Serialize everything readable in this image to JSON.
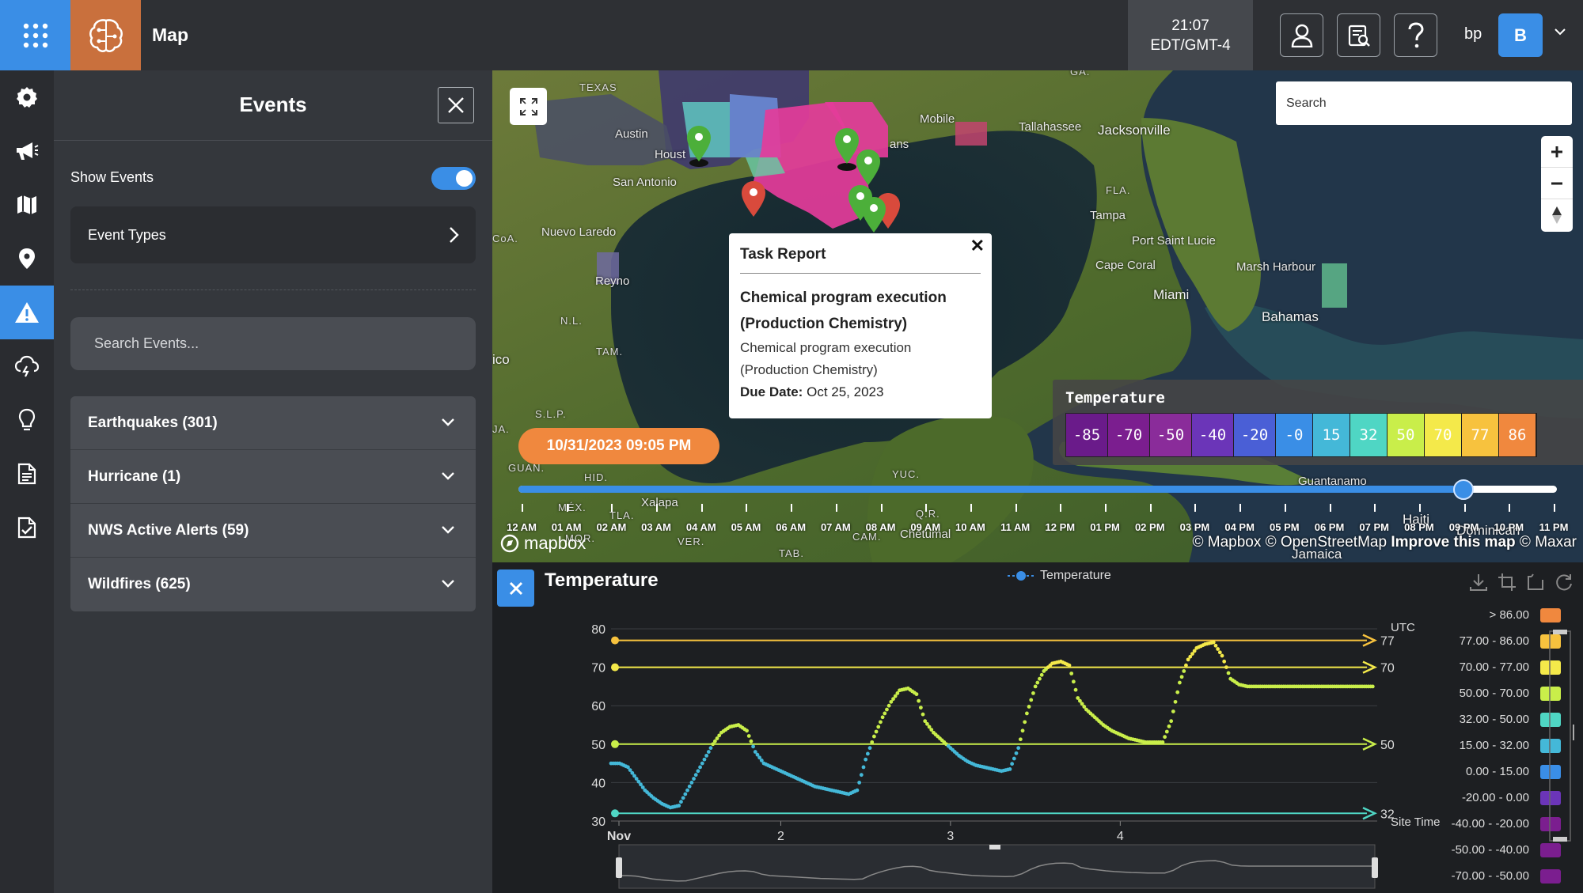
{
  "topbar": {
    "app_title": "Map",
    "clock_time": "21:07",
    "clock_zone": "EDT/GMT-4",
    "user_initials": "bp",
    "avatar_letter": "B"
  },
  "rail": {
    "items": [
      "settings",
      "announcements",
      "map",
      "locations",
      "events",
      "weather",
      "insights",
      "reports",
      "tasks"
    ],
    "active_index": 4
  },
  "events_panel": {
    "title": "Events",
    "show_events_label": "Show Events",
    "show_events_on": true,
    "event_types_label": "Event Types",
    "search_placeholder": "Search Events...",
    "categories": [
      {
        "label": "Earthquakes (301)"
      },
      {
        "label": "Hurricane (1)"
      },
      {
        "label": "NWS Active Alerts (59)"
      },
      {
        "label": "Wildfires (625)"
      }
    ]
  },
  "map": {
    "search_placeholder": "Search",
    "labels": [
      "TEXAS",
      "Austin",
      "Houst",
      "San Antonio",
      "Nuevo Laredo",
      "Reyno",
      "Mobile",
      "Tallahassee",
      "Jacksonville",
      "FLA.",
      "Tampa",
      "Port Saint Lucie",
      "Cape Coral",
      "Marsh Harbour",
      "Miami",
      "Bahamas",
      "N.L.",
      "TAM.",
      "S.L.P.",
      "GUAN.",
      "HID.",
      "MÉX.",
      "TLA.",
      "Xalapa",
      "VER.",
      "YUC.",
      "Q.R.",
      "Chetumal",
      "CAM.",
      "TAB.",
      "Guantanamo",
      "Haiti",
      "Jamaica",
      "Dominican",
      "GA.",
      "ans",
      "ico",
      "CoA.",
      "JA.",
      "MOR."
    ],
    "popup": {
      "title": "Task Report",
      "heading": "Chemical program execution (Production Chemistry)",
      "body": "Chemical program execution (Production Chemistry)",
      "due_label": "Due Date:",
      "due_value": "Oct 25, 2023"
    },
    "legend": {
      "title": "Temperature",
      "values": [
        "-85",
        "-70",
        "-50",
        "-40",
        "-20",
        "-0",
        "15",
        "32",
        "50",
        "70",
        "77",
        "86"
      ],
      "colors": [
        "#6a1b8a",
        "#7b1e8f",
        "#8a2c9a",
        "#6b35b8",
        "#4a5fd6",
        "#3a8ee6",
        "#44b8d8",
        "#4fd6c4",
        "#c9ee4a",
        "#f4e94a",
        "#f7c23e",
        "#f0883e"
      ]
    },
    "time_pill": "10/31/2023 09:05 PM",
    "timeline_position": 0.91,
    "timeline_labels": [
      "12 AM",
      "01 AM",
      "02 AM",
      "03 AM",
      "04 AM",
      "05 AM",
      "06 AM",
      "07 AM",
      "08 AM",
      "09 AM",
      "10 AM",
      "11 AM",
      "12 PM",
      "01 PM",
      "02 PM",
      "03 PM",
      "04 PM",
      "05 PM",
      "06 PM",
      "07 PM",
      "08 PM",
      "09 PM",
      "10 PM",
      "11 PM"
    ],
    "mapbox_logo": "mapbox",
    "attribution_pre": "© Mapbox © OpenStreetMap ",
    "attribution_bold": "Improve this map",
    "attribution_post": " © Maxar"
  },
  "chart_panel": {
    "title": "Temperature",
    "legend_label": "Temperature",
    "utc_label": "UTC",
    "site_time_label": "Site Time",
    "ranges": [
      {
        "label": "> 86.00",
        "color": "#f0883e"
      },
      {
        "label": "77.00 - 86.00",
        "color": "#f7c23e"
      },
      {
        "label": "70.00 - 77.00",
        "color": "#f4e94a"
      },
      {
        "label": "50.00 - 70.00",
        "color": "#c9ee4a"
      },
      {
        "label": "32.00 - 50.00",
        "color": "#4fd6c4"
      },
      {
        "label": "15.00 - 32.00",
        "color": "#44b8d8"
      },
      {
        "label": "0.00 - 15.00",
        "color": "#3a8ee6"
      },
      {
        "label": "-20.00 - 0.00",
        "color": "#6b35b8"
      },
      {
        "label": "-40.00 - -20.00",
        "color": "#7b1e8f"
      },
      {
        "label": "-50.00 - -40.00",
        "color": "#7b1e8f"
      },
      {
        "label": "-70.00 - -50.00",
        "color": "#7b1e8f"
      }
    ]
  },
  "chart_data": {
    "type": "line",
    "title": "Temperature",
    "series": [
      {
        "name": "Temperature",
        "x": [
          0,
          0.05,
          0.1,
          0.15,
          0.2,
          0.25,
          0.3,
          0.35,
          0.4,
          0.45,
          0.5,
          0.55,
          0.6,
          0.65,
          0.7,
          0.75,
          0.8,
          0.85,
          0.9,
          0.95,
          1.0,
          1.05,
          1.1,
          1.15,
          1.2,
          1.25,
          1.3,
          1.35,
          1.4,
          1.45,
          1.5,
          1.55,
          1.6,
          1.65,
          1.7,
          1.75,
          1.8,
          1.85,
          1.9,
          1.95,
          2.0,
          2.05,
          2.1,
          2.15,
          2.2,
          2.25,
          2.3,
          2.35,
          2.4,
          2.45,
          2.5,
          2.55,
          2.6,
          2.65,
          2.7,
          2.75,
          2.8,
          2.85,
          2.9,
          2.95,
          3.0,
          3.05,
          3.1,
          3.15,
          3.2,
          3.25,
          3.3,
          3.35,
          3.4,
          3.45,
          3.5,
          3.55,
          3.6,
          3.65,
          3.7,
          3.75,
          3.8,
          3.85,
          3.9,
          3.95,
          4.0,
          4.05,
          4.1,
          4.15,
          4.2,
          4.25,
          4.3,
          4.35,
          4.4,
          4.45,
          4.5
        ],
        "values": [
          45,
          45,
          44,
          41,
          38,
          36,
          34.5,
          33.5,
          34,
          38,
          42,
          46,
          50,
          53,
          54.5,
          55,
          53.5,
          48,
          45,
          44,
          43,
          42,
          41,
          40,
          39,
          38.5,
          38,
          37.5,
          37,
          38,
          46,
          52,
          57,
          61,
          64,
          64.5,
          63,
          56,
          53,
          51,
          49,
          47,
          45.5,
          44.5,
          44,
          43.5,
          43,
          43.5,
          49,
          58,
          65,
          69,
          71,
          71.5,
          70.5,
          62,
          59,
          57,
          55,
          53.5,
          52.5,
          51.5,
          51,
          50.5,
          50.5,
          50.5,
          56,
          66,
          72,
          75,
          76,
          76.5,
          73,
          67,
          65.5,
          65,
          65,
          65,
          65,
          65,
          65,
          65,
          65,
          65,
          65,
          65,
          65,
          65,
          65,
          65,
          65
        ],
        "color": "#44b8d8"
      }
    ],
    "x_ticks": [
      "Nov",
      "2",
      "3",
      "4"
    ],
    "y_ticks": [
      30,
      40,
      50,
      60,
      70,
      80
    ],
    "ylim": [
      30,
      80
    ],
    "thresholds": [
      {
        "value": 77,
        "color": "#f7c23e"
      },
      {
        "value": 70,
        "color": "#f4e94a"
      },
      {
        "value": 50,
        "color": "#c9ee4a"
      },
      {
        "value": 32,
        "color": "#4fd6c4"
      }
    ],
    "grid": true
  }
}
